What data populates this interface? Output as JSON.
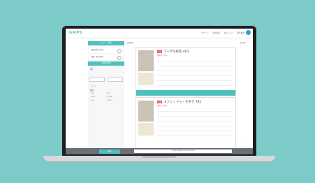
{
  "app": {
    "logo": "GAIPS"
  },
  "topnav": [
    "ログイン",
    "新規会員",
    "お気に入り",
    "閲覧履歴"
  ],
  "sidebar": {
    "head": "エリア・駅名",
    "rows": [
      "都道府県から探す",
      "路線・駅から探す"
    ],
    "head2": "条件を変更",
    "labels": [
      "賃料",
      "間取り"
    ]
  },
  "toolbar": {
    "count": "検索結果",
    "sort": "並び替え"
  },
  "cards": [
    {
      "badge": "新着",
      "title": "アーデル町北 403",
      "price": "賃料 6.2万円"
    },
    {
      "badge": "新着",
      "title": "メゾン・ドゥ・セモア 701",
      "price": "賃料 7.4万円"
    }
  ],
  "bottom": {
    "button": "検索",
    "note": "この条件で新着物件のお知らせを受け取る"
  },
  "colors": {
    "accent": "#4ec0bd",
    "badge": "#e0504b",
    "background": "#7ccbc9"
  }
}
